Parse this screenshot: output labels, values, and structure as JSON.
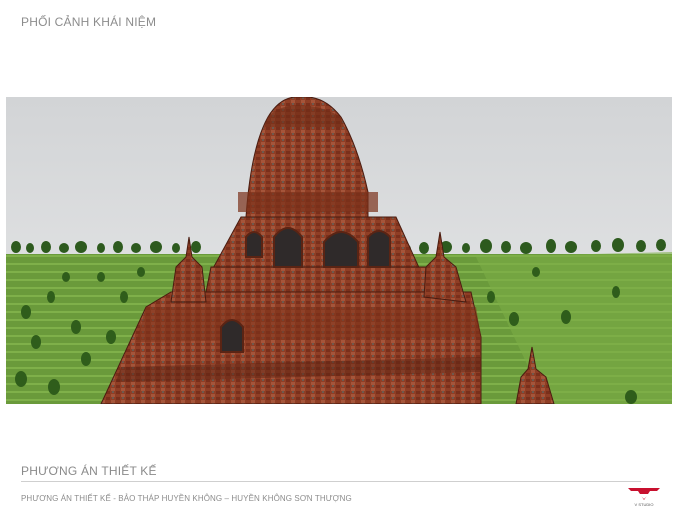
{
  "page": {
    "heading": "PHỐI CẢNH KHÁI NIỆM",
    "section_title": "PHƯƠNG ÁN THIẾT KẾ",
    "caption": "PHƯƠNG ÁN THIẾT KẾ - BẢO THÁP HUYỀN KHÔNG – HUYỀN KHÔNG SƠN THƯỢNG"
  },
  "logo": {
    "text": "V STUDIO",
    "color": "#c8102e"
  },
  "render": {
    "subject": "pagoda-stupa-render",
    "colors": {
      "sky": "#dcdedf",
      "grass": "#5f8d35",
      "grass_light": "#78a444",
      "brick": "#8e3c24",
      "brick_dark": "#5b2416",
      "tree": "#2f5a1c"
    }
  }
}
